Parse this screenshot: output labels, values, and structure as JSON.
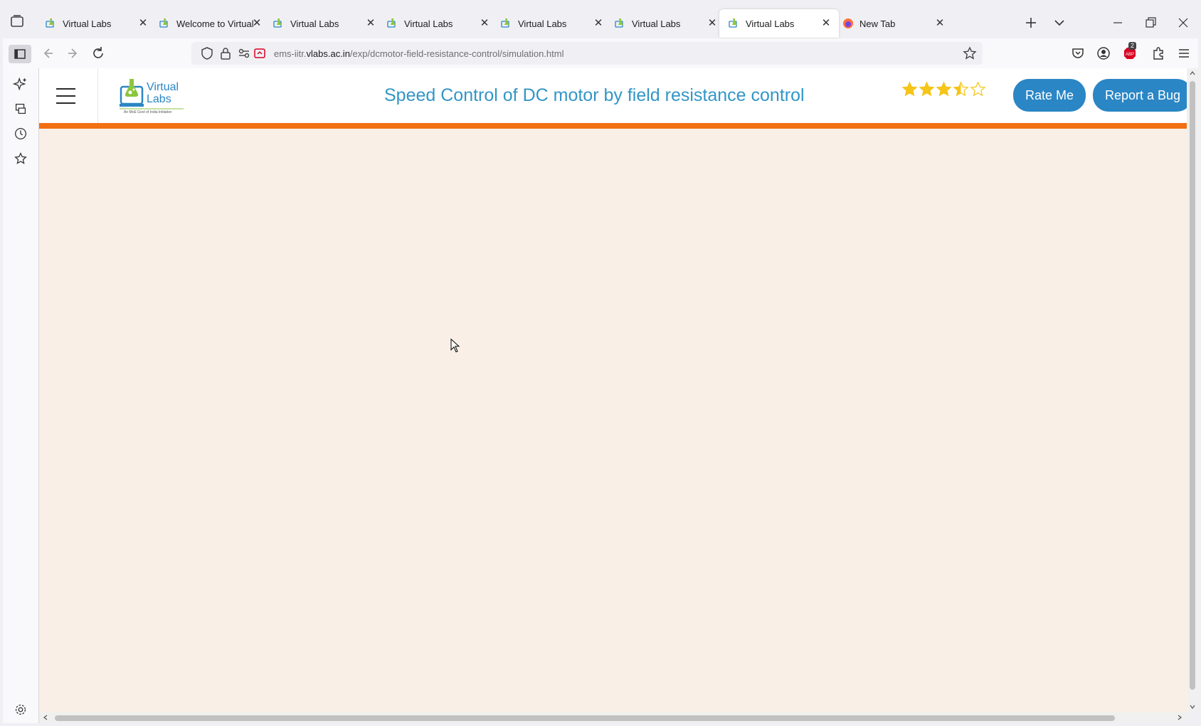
{
  "browser": {
    "tabs": [
      {
        "title": "Virtual Labs",
        "active": false,
        "icon": "vlabs-favicon"
      },
      {
        "title": "Welcome to Virtual La",
        "active": false,
        "icon": "vlabs-favicon"
      },
      {
        "title": "Virtual Labs",
        "active": false,
        "icon": "vlabs-favicon"
      },
      {
        "title": "Virtual Labs",
        "active": false,
        "icon": "vlabs-favicon"
      },
      {
        "title": "Virtual Labs",
        "active": false,
        "icon": "vlabs-favicon"
      },
      {
        "title": "Virtual Labs",
        "active": false,
        "icon": "vlabs-favicon"
      },
      {
        "title": "Virtual Labs",
        "active": true,
        "icon": "vlabs-favicon"
      },
      {
        "title": "New Tab",
        "active": false,
        "icon": "firefox-favicon"
      }
    ],
    "url": {
      "prefix": "ems-iitr.",
      "host": "vlabs.ac.in",
      "path": "/exp/dcmotor-field-resistance-control/simulation.html"
    },
    "abp_badge": "2",
    "accent_color": "#f27013"
  },
  "page": {
    "logo_alt": "Virtual Labs",
    "logo_tagline": "An MoE Govt of India Initiative",
    "title": "Speed Control of DC motor by field resistance control",
    "rating": 3.5,
    "rating_max": 5,
    "rate_button": "Rate Me",
    "bug_button": "Report a Bug",
    "background_color": "#f9efe6",
    "title_color": "#3296c6",
    "button_color": "#2a86c5"
  }
}
